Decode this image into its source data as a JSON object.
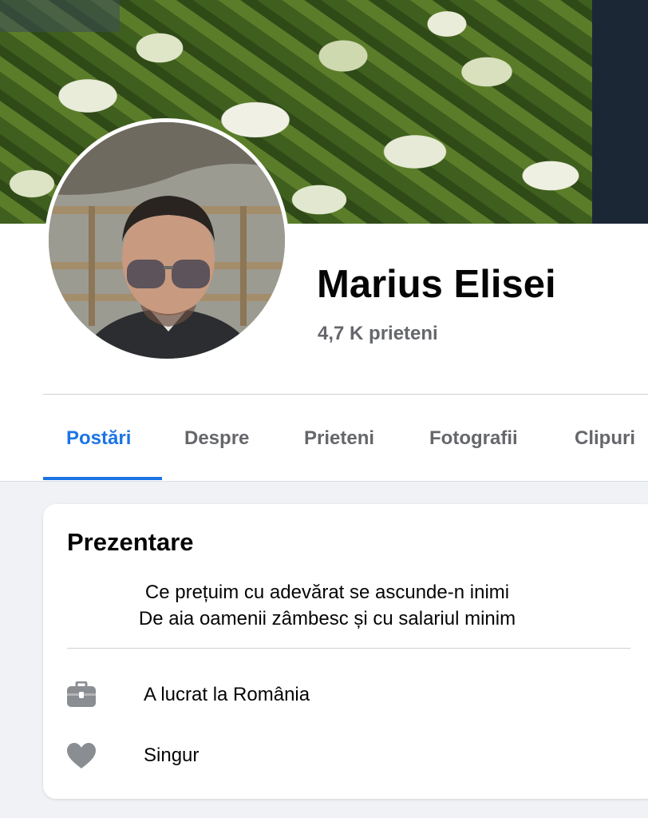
{
  "profile": {
    "name": "Marius Elisei",
    "friends": "4,7 K prieteni"
  },
  "tabs": [
    {
      "label": "Postări",
      "active": true
    },
    {
      "label": "Despre",
      "active": false
    },
    {
      "label": "Prieteni",
      "active": false
    },
    {
      "label": "Fotografii",
      "active": false
    },
    {
      "label": "Clipuri",
      "active": false
    }
  ],
  "intro": {
    "title": "Prezentare",
    "bio_line1": "Ce prețuim cu adevărat se ascunde-n inimi",
    "bio_line2": "De aia oamenii zâmbesc și cu salariul minim",
    "details": [
      {
        "icon": "briefcase-icon",
        "text": "A lucrat la România"
      },
      {
        "icon": "heart-icon",
        "text": "Singur"
      }
    ]
  },
  "colors": {
    "accent": "#1b74e4",
    "secondary_text": "#65676b",
    "page_bg": "#f0f2f5"
  }
}
